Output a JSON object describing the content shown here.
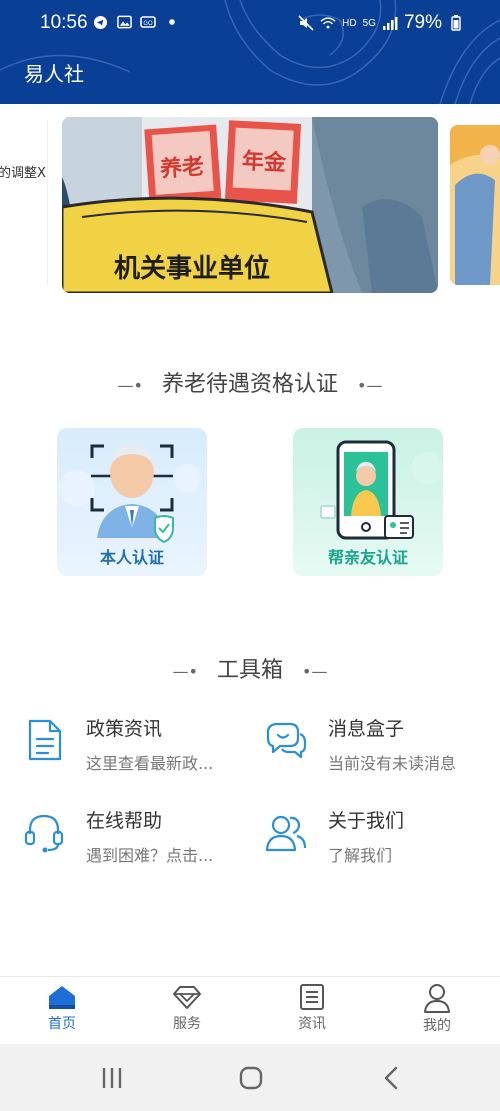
{
  "status_bar": {
    "time": "10:56",
    "network_label": "HD",
    "signal_label": "5G",
    "battery": "79%"
  },
  "app": {
    "title": "易人社"
  },
  "banner": {
    "left_text": "的调整X",
    "main_badge_1": "养老",
    "main_badge_2": "年金",
    "main_caption": "机关事业单位"
  },
  "certification": {
    "title": "养老待遇资格认证",
    "self_label": "本人认证",
    "family_label": "帮亲友认证"
  },
  "toolbox": {
    "title": "工具箱",
    "items": [
      {
        "title": "政策资讯",
        "subtitle": "这里查看最新政...",
        "icon": "document-icon"
      },
      {
        "title": "消息盒子",
        "subtitle": "当前没有未读消息",
        "icon": "chat-bubbles-icon"
      },
      {
        "title": "在线帮助",
        "subtitle": "遇到困难？点击...",
        "icon": "headset-icon"
      },
      {
        "title": "关于我们",
        "subtitle": "了解我们",
        "icon": "people-icon"
      }
    ]
  },
  "bottom_nav": {
    "items": [
      {
        "label": "首页",
        "icon": "home-icon",
        "active": true
      },
      {
        "label": "服务",
        "icon": "diamond-icon",
        "active": false
      },
      {
        "label": "资讯",
        "icon": "list-icon",
        "active": false
      },
      {
        "label": "我的",
        "icon": "user-icon",
        "active": false
      }
    ]
  },
  "colors": {
    "header": "#0a3f96",
    "accent_blue": "#1d6fd6",
    "accent_green": "#18a58a"
  }
}
